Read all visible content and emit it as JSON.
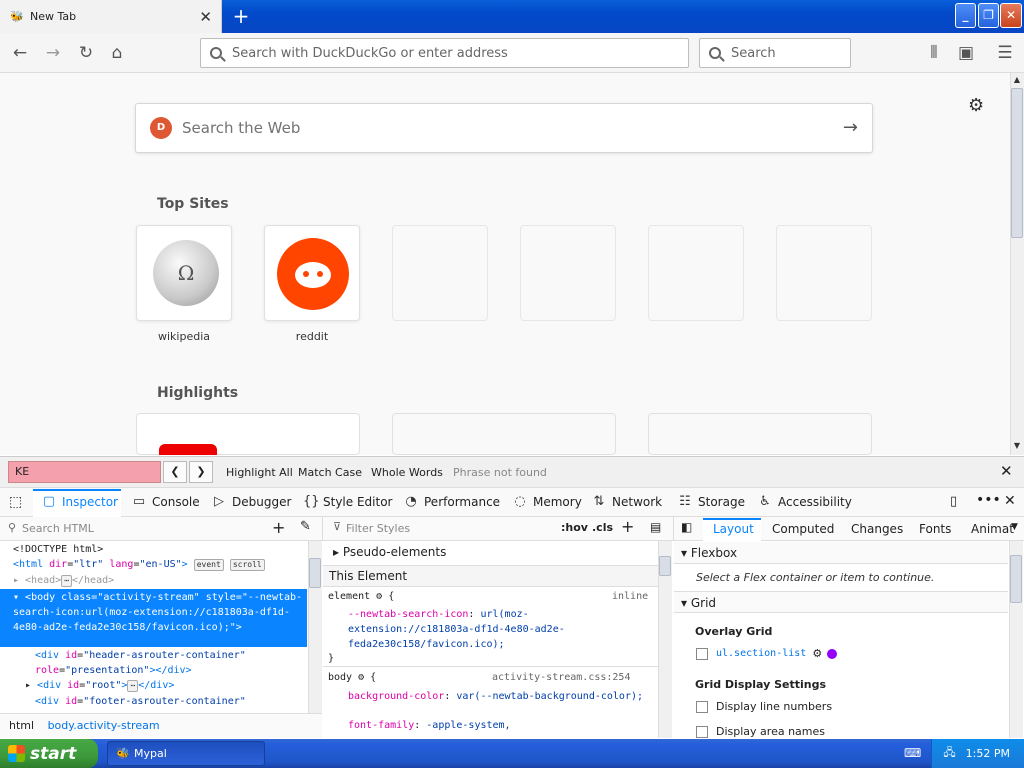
{
  "browser": {
    "tab_title": "New Tab",
    "url_placeholder": "Search with DuckDuckGo or enter address",
    "search_placeholder": "Search"
  },
  "newtab": {
    "web_search_placeholder": "Search the Web",
    "ddg_letter": "D",
    "top_sites_heading": "Top Sites",
    "highlights_heading": "Highlights",
    "sites": [
      {
        "label": "wikipedia"
      },
      {
        "label": "reddit"
      }
    ]
  },
  "findbar": {
    "query": "KE",
    "highlight_all": "Highlight All",
    "match_case": "Match Case",
    "whole_words": "Whole Words",
    "status": "Phrase not found"
  },
  "devtools": {
    "tabs": [
      "Inspector",
      "Console",
      "Debugger",
      "Style Editor",
      "Performance",
      "Memory",
      "Network",
      "Storage",
      "Accessibility"
    ],
    "search_html_placeholder": "Search HTML",
    "filter_styles_placeholder": "Filter Styles",
    "hov": ":hov",
    "cls": ".cls",
    "layout_tabs": [
      "Layout",
      "Computed",
      "Changes",
      "Fonts",
      "Animat"
    ],
    "html_lines": {
      "l1": "<!DOCTYPE html>",
      "body_style": "--newtab-search-icon:url(moz-extension://c181803a-df1d-4e80-ad2e-feda2e30c158/favicon.ico);",
      "div_header": "header-asrouter-container",
      "div_header_role": "presentation",
      "div_root": "root",
      "div_footer": "footer-asrouter-container"
    },
    "breadcrumb": {
      "a": "html",
      "b": "body.activity-stream"
    },
    "rules": {
      "pseudo": "Pseudo-elements",
      "this_element": "This Element",
      "element_sel": "element",
      "inline": "inline",
      "prop1": "--newtab-search-icon",
      "val1": "url(moz-extension://c181803a-df1d-4e80-ad2e-feda2e30c158/favicon.ico);",
      "body_sel": "body",
      "source": "activity-stream.css:254",
      "prop2": "background-color",
      "val2": "var(--newtab-background-color);",
      "prop3": "font-family",
      "val3": "-apple-system,"
    },
    "layout": {
      "flexbox": "Flexbox",
      "flex_hint": "Select a Flex container or item to continue.",
      "grid": "Grid",
      "overlay_grid": "Overlay Grid",
      "grid_item": "ul.section-list",
      "display_settings": "Grid Display Settings",
      "opt1": "Display line numbers",
      "opt2": "Display area names"
    }
  },
  "taskbar": {
    "start": "start",
    "item": "Mypal",
    "clock": "1:52 PM"
  }
}
